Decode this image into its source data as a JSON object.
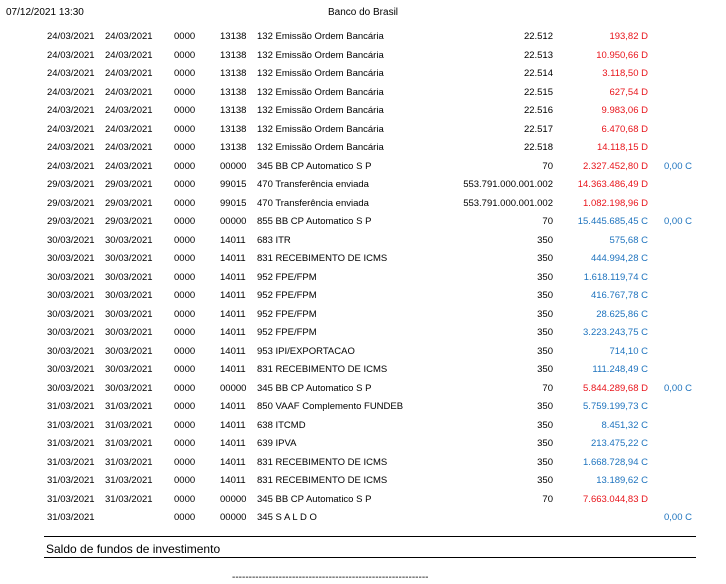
{
  "header": {
    "datetime": "07/12/2021 13:30",
    "bank": "Banco do Brasil"
  },
  "colors": {
    "debit": "#e8141b",
    "credit": "#1e73be",
    "text": "#000000"
  },
  "rows": [
    {
      "d1": "24/03/2021",
      "d2": "24/03/2021",
      "ag": "0000",
      "lt": "13138",
      "desc": "132 Emissão Ordem Bancária",
      "doc": "22.512",
      "val": "193,82 D",
      "vt": "debit",
      "sal": "",
      "st": ""
    },
    {
      "d1": "24/03/2021",
      "d2": "24/03/2021",
      "ag": "0000",
      "lt": "13138",
      "desc": "132 Emissão Ordem Bancária",
      "doc": "22.513",
      "val": "10.950,66 D",
      "vt": "debit",
      "sal": "",
      "st": ""
    },
    {
      "d1": "24/03/2021",
      "d2": "24/03/2021",
      "ag": "0000",
      "lt": "13138",
      "desc": "132 Emissão Ordem Bancária",
      "doc": "22.514",
      "val": "3.118,50 D",
      "vt": "debit",
      "sal": "",
      "st": ""
    },
    {
      "d1": "24/03/2021",
      "d2": "24/03/2021",
      "ag": "0000",
      "lt": "13138",
      "desc": "132 Emissão Ordem Bancária",
      "doc": "22.515",
      "val": "627,54 D",
      "vt": "debit",
      "sal": "",
      "st": ""
    },
    {
      "d1": "24/03/2021",
      "d2": "24/03/2021",
      "ag": "0000",
      "lt": "13138",
      "desc": "132 Emissão Ordem Bancária",
      "doc": "22.516",
      "val": "9.983,06 D",
      "vt": "debit",
      "sal": "",
      "st": ""
    },
    {
      "d1": "24/03/2021",
      "d2": "24/03/2021",
      "ag": "0000",
      "lt": "13138",
      "desc": "132 Emissão Ordem Bancária",
      "doc": "22.517",
      "val": "6.470,68 D",
      "vt": "debit",
      "sal": "",
      "st": ""
    },
    {
      "d1": "24/03/2021",
      "d2": "24/03/2021",
      "ag": "0000",
      "lt": "13138",
      "desc": "132 Emissão Ordem Bancária",
      "doc": "22.518",
      "val": "14.118,15 D",
      "vt": "debit",
      "sal": "",
      "st": ""
    },
    {
      "d1": "24/03/2021",
      "d2": "24/03/2021",
      "ag": "0000",
      "lt": "00000",
      "desc": "345 BB CP Automatico S P",
      "doc": "70",
      "val": "2.327.452,80 D",
      "vt": "debit",
      "sal": "0,00 C",
      "st": "credit"
    },
    {
      "d1": "29/03/2021",
      "d2": "29/03/2021",
      "ag": "0000",
      "lt": "99015",
      "desc": "470 Transferência enviada",
      "doc": "553.791.000.001.002",
      "val": "14.363.486,49 D",
      "vt": "debit",
      "sal": "",
      "st": ""
    },
    {
      "d1": "29/03/2021",
      "d2": "29/03/2021",
      "ag": "0000",
      "lt": "99015",
      "desc": "470 Transferência enviada",
      "doc": "553.791.000.001.002",
      "val": "1.082.198,96 D",
      "vt": "debit",
      "sal": "",
      "st": ""
    },
    {
      "d1": "29/03/2021",
      "d2": "29/03/2021",
      "ag": "0000",
      "lt": "00000",
      "desc": "855 BB CP Automatico S P",
      "doc": "70",
      "val": "15.445.685,45 C",
      "vt": "credit",
      "sal": "0,00 C",
      "st": "credit"
    },
    {
      "d1": "30/03/2021",
      "d2": "30/03/2021",
      "ag": "0000",
      "lt": "14011",
      "desc": "683 ITR",
      "doc": "350",
      "val": "575,68 C",
      "vt": "credit",
      "sal": "",
      "st": ""
    },
    {
      "d1": "30/03/2021",
      "d2": "30/03/2021",
      "ag": "0000",
      "lt": "14011",
      "desc": "831 RECEBIMENTO DE ICMS",
      "doc": "350",
      "val": "444.994,28 C",
      "vt": "credit",
      "sal": "",
      "st": ""
    },
    {
      "d1": "30/03/2021",
      "d2": "30/03/2021",
      "ag": "0000",
      "lt": "14011",
      "desc": "952 FPE/FPM",
      "doc": "350",
      "val": "1.618.119,74 C",
      "vt": "credit",
      "sal": "",
      "st": ""
    },
    {
      "d1": "30/03/2021",
      "d2": "30/03/2021",
      "ag": "0000",
      "lt": "14011",
      "desc": "952 FPE/FPM",
      "doc": "350",
      "val": "416.767,78 C",
      "vt": "credit",
      "sal": "",
      "st": ""
    },
    {
      "d1": "30/03/2021",
      "d2": "30/03/2021",
      "ag": "0000",
      "lt": "14011",
      "desc": "952 FPE/FPM",
      "doc": "350",
      "val": "28.625,86 C",
      "vt": "credit",
      "sal": "",
      "st": ""
    },
    {
      "d1": "30/03/2021",
      "d2": "30/03/2021",
      "ag": "0000",
      "lt": "14011",
      "desc": "952 FPE/FPM",
      "doc": "350",
      "val": "3.223.243,75 C",
      "vt": "credit",
      "sal": "",
      "st": ""
    },
    {
      "d1": "30/03/2021",
      "d2": "30/03/2021",
      "ag": "0000",
      "lt": "14011",
      "desc": "953 IPI/EXPORTACAO",
      "doc": "350",
      "val": "714,10 C",
      "vt": "credit",
      "sal": "",
      "st": ""
    },
    {
      "d1": "30/03/2021",
      "d2": "30/03/2021",
      "ag": "0000",
      "lt": "14011",
      "desc": "831 RECEBIMENTO DE ICMS",
      "doc": "350",
      "val": "111.248,49 C",
      "vt": "credit",
      "sal": "",
      "st": ""
    },
    {
      "d1": "30/03/2021",
      "d2": "30/03/2021",
      "ag": "0000",
      "lt": "00000",
      "desc": "345 BB CP Automatico S P",
      "doc": "70",
      "val": "5.844.289,68 D",
      "vt": "debit",
      "sal": "0,00 C",
      "st": "credit"
    },
    {
      "d1": "31/03/2021",
      "d2": "31/03/2021",
      "ag": "0000",
      "lt": "14011",
      "desc": "850 VAAF Complemento FUNDEB",
      "doc": "350",
      "val": "5.759.199,73 C",
      "vt": "credit",
      "sal": "",
      "st": ""
    },
    {
      "d1": "31/03/2021",
      "d2": "31/03/2021",
      "ag": "0000",
      "lt": "14011",
      "desc": "638 ITCMD",
      "doc": "350",
      "val": "8.451,32 C",
      "vt": "credit",
      "sal": "",
      "st": ""
    },
    {
      "d1": "31/03/2021",
      "d2": "31/03/2021",
      "ag": "0000",
      "lt": "14011",
      "desc": "639 IPVA",
      "doc": "350",
      "val": "213.475,22 C",
      "vt": "credit",
      "sal": "",
      "st": ""
    },
    {
      "d1": "31/03/2021",
      "d2": "31/03/2021",
      "ag": "0000",
      "lt": "14011",
      "desc": "831 RECEBIMENTO DE ICMS",
      "doc": "350",
      "val": "1.668.728,94 C",
      "vt": "credit",
      "sal": "",
      "st": ""
    },
    {
      "d1": "31/03/2021",
      "d2": "31/03/2021",
      "ag": "0000",
      "lt": "14011",
      "desc": "831 RECEBIMENTO DE ICMS",
      "doc": "350",
      "val": "13.189,62 C",
      "vt": "credit",
      "sal": "",
      "st": ""
    },
    {
      "d1": "31/03/2021",
      "d2": "31/03/2021",
      "ag": "0000",
      "lt": "00000",
      "desc": "345 BB CP Automatico S P",
      "doc": "70",
      "val": "7.663.044,83 D",
      "vt": "debit",
      "sal": "",
      "st": ""
    },
    {
      "d1": "31/03/2021",
      "d2": "",
      "ag": "0000",
      "lt": "00000",
      "desc": "345 S A L D O",
      "doc": "",
      "val": "",
      "vt": "",
      "sal": "0,00 C",
      "st": "credit"
    }
  ],
  "section": {
    "title": "Saldo de fundos de investimento"
  },
  "footer": {
    "dashes": "-----------------------------------------------------------"
  }
}
